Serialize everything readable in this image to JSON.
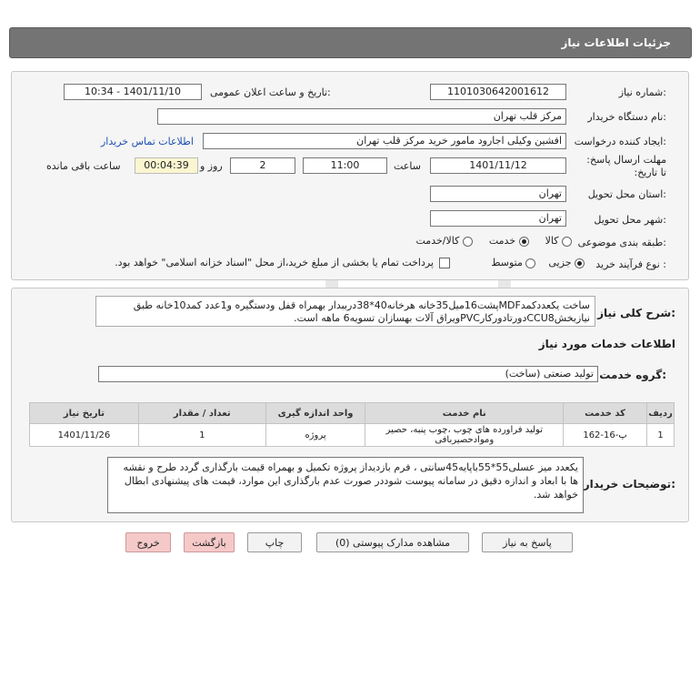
{
  "header": {
    "title": "جزئیات اطلاعات نیاز"
  },
  "form": {
    "need_number_label": "شماره نیاز:",
    "need_number": "1101030642001612",
    "announce_datetime_label": "تاریخ و ساعت اعلان عمومی:",
    "announce_datetime": "1401/11/10 - 10:34",
    "buyer_org_label": "نام دستگاه خریدار:",
    "buyer_org": "مرکز قلب تهران",
    "requester_label": "ایجاد کننده درخواست:",
    "requester": "افشین وکیلی اجارود مامور خرید مرکز قلب تهران",
    "buyer_contact_link": "اطلاعات تماس خریدار",
    "deadline_label": "مهلت ارسال پاسخ: تا تاریخ:",
    "deadline_date": "1401/11/12",
    "time_label": "ساعت",
    "deadline_time": "11:00",
    "days_value": "2",
    "days_label": "روز و",
    "remaining_time": "00:04:39",
    "remaining_label": "ساعت باقی مانده",
    "province_label": "استان محل تحویل:",
    "province": "تهران",
    "city_label": "شهر محل تحویل:",
    "city": "تهران",
    "category_label": "طبقه بندی موضوعی:",
    "category_options": [
      "کالا",
      "خدمت",
      "کالا/خدمت"
    ],
    "category_selected": "خدمت",
    "process_label": "نوع فرآیند خرید :",
    "process_options": [
      "جزیی",
      "متوسط"
    ],
    "process_selected": "جزیی",
    "treasury_note": "پرداخت تمام یا بخشی از مبلغ خرید،از محل \"اسناد خزانه اسلامی\" خواهد بود."
  },
  "details": {
    "summary_label": "شرح کلی نیاز:",
    "summary": "ساخت یکعددکمدMDFپشت16میل35خانه هرخانه40*38درببدار بهمراه قفل ودستگیره و1عدد کمد10خانه طبق نیازبخشCCU8دورتادورکارPVCویراق آلات بهسازان تسویه6 ماهه است.",
    "services_info_title": "اطلاعات خدمات مورد نیاز",
    "service_group_label": "گروه خدمت:",
    "service_group": "تولید صنعتی (ساخت)",
    "table": {
      "headers": [
        "ردیف",
        "کد خدمت",
        "نام خدمت",
        "واحد اندازه گیری",
        "تعداد / مقدار",
        "تاریخ نیاز"
      ],
      "rows": [
        [
          "1",
          "پ-16-162",
          "تولید فراورده های چوب ،چوب پنبه، حصیر وموادحصیربافی",
          "پروژه",
          "1",
          "1401/11/26"
        ]
      ]
    },
    "buyer_notes_label": "توضیحات خریدار:",
    "buyer_notes": "یکعدد میز عسلی55*55باپایه45سانتی ، فرم بازدیداز پروژه تکمیل و بهمراه قیمت بارگذاری گردد طرح و نقشه ها با ابعاد و اندازه دقیق در سامانه پیوست شوددر صورت عدم بارگذاری این موارد، قیمت های پیشنهادی ابطال خواهد شد."
  },
  "buttons": {
    "reply": "پاسخ به نیاز",
    "attachments": "مشاهده مدارک پیوستی (0)",
    "print": "چاپ",
    "back": "بازگشت",
    "exit": "خروج"
  }
}
